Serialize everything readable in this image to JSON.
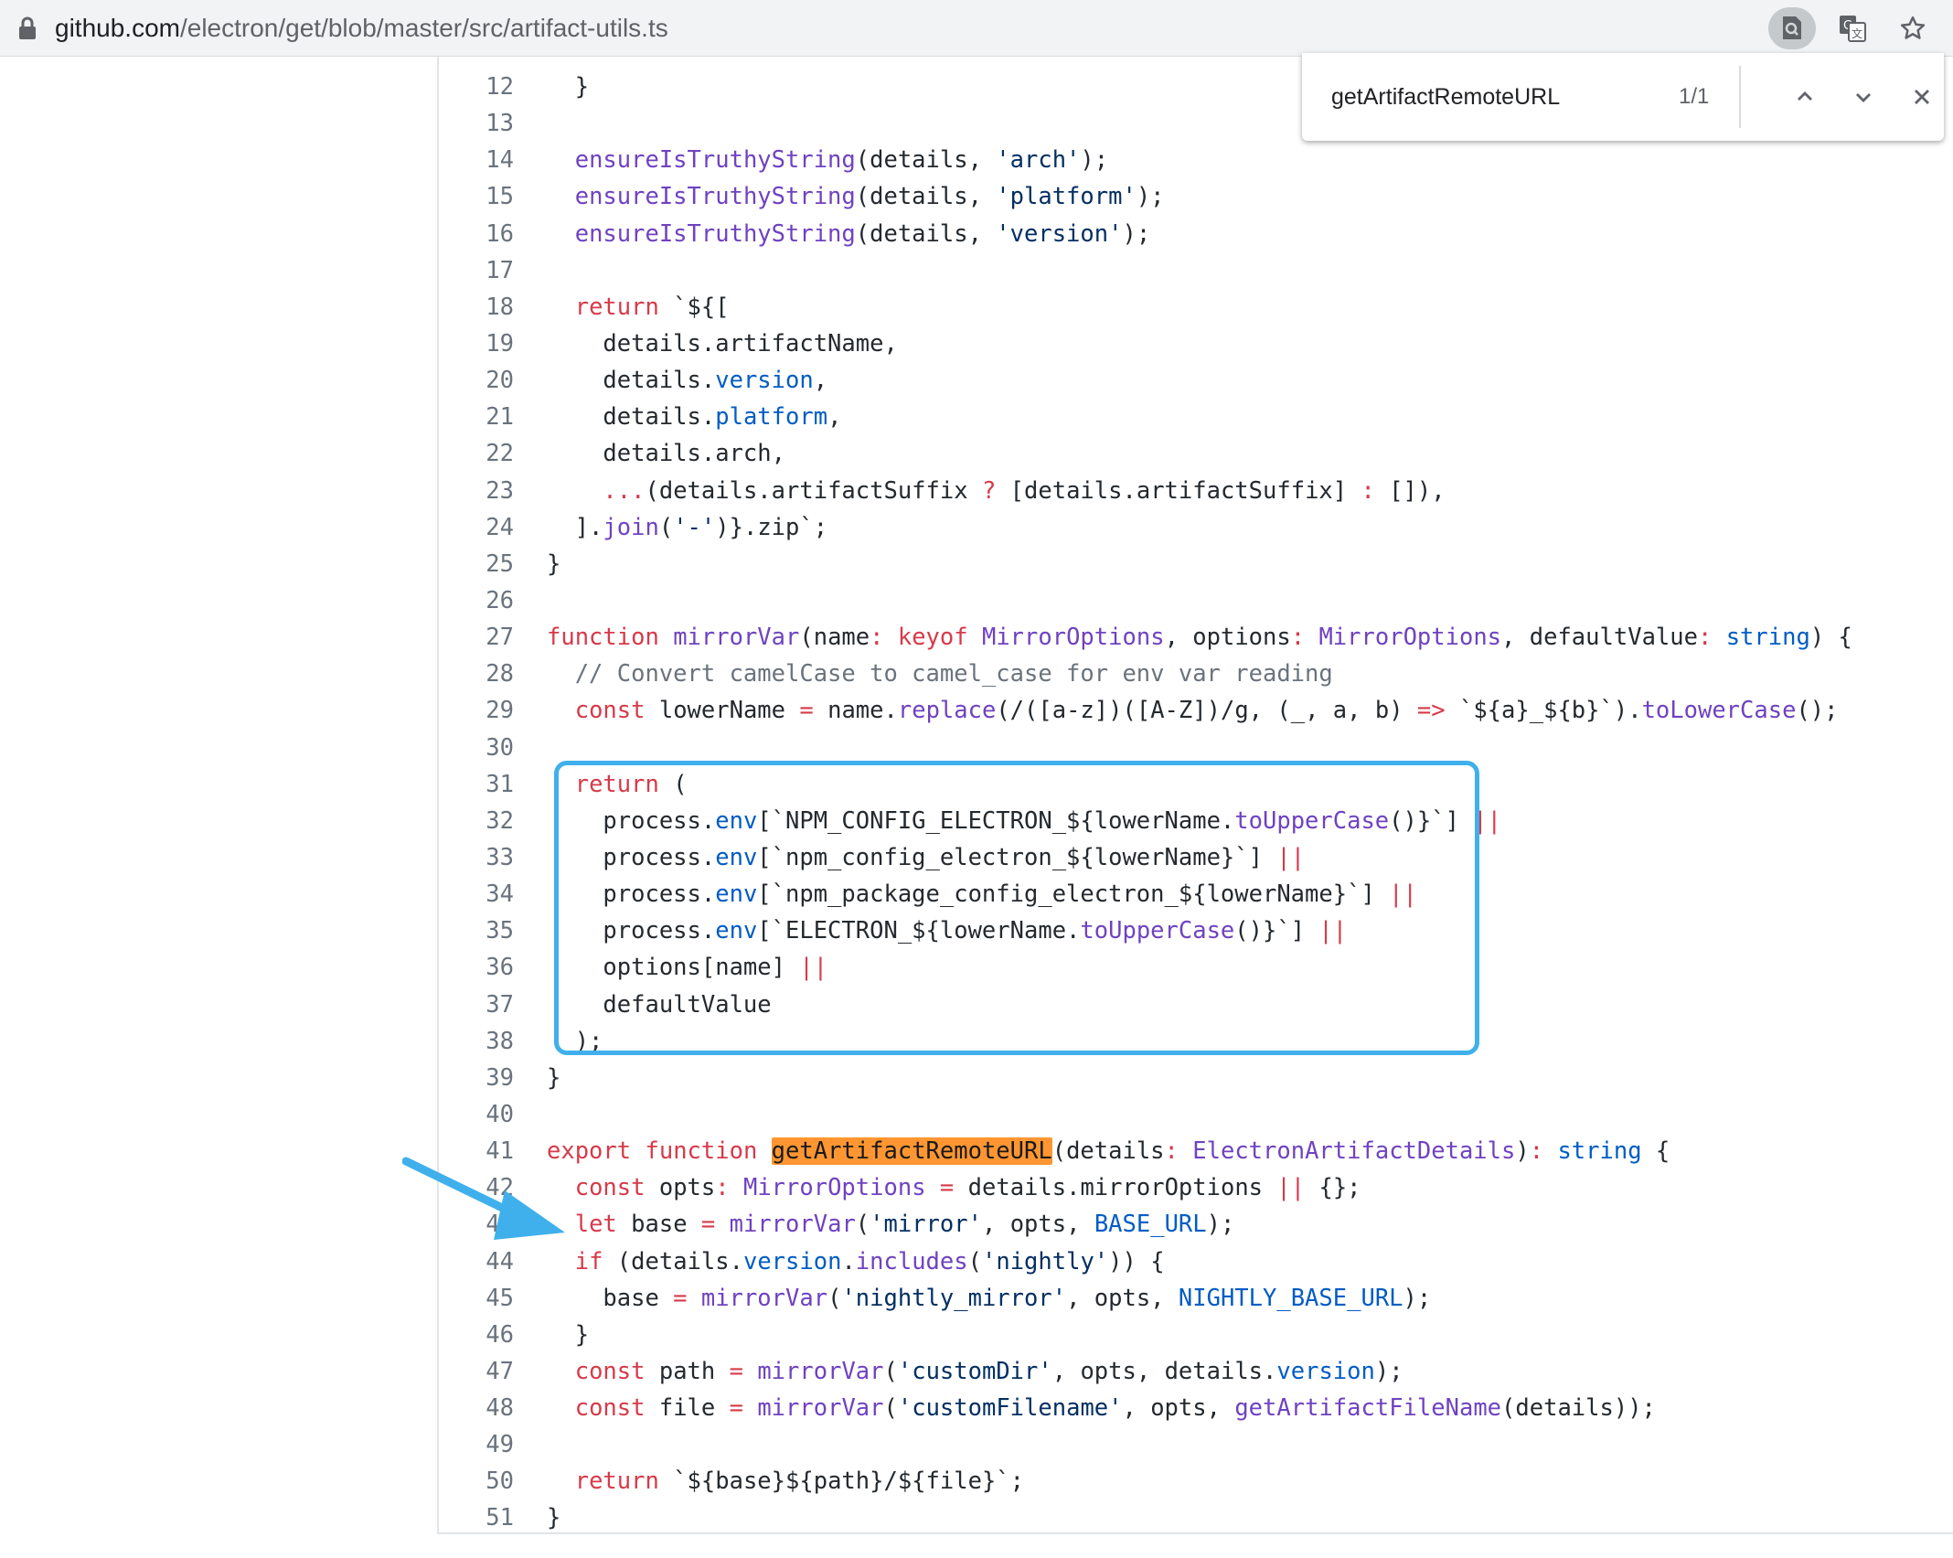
{
  "address_bar": {
    "url_domain": "github.com",
    "url_path": "/electron/get/blob/master/src/artifact-utils.ts"
  },
  "find_bar": {
    "query": "getArtifactRemoteURL",
    "count": "1/1"
  },
  "code": {
    "lines": [
      {
        "n": "12",
        "t": "  }"
      },
      {
        "n": "13",
        "t": ""
      },
      {
        "n": "14",
        "t": "  ensureIsTruthyString(details, 'arch');"
      },
      {
        "n": "15",
        "t": "  ensureIsTruthyString(details, 'platform');"
      },
      {
        "n": "16",
        "t": "  ensureIsTruthyString(details, 'version');"
      },
      {
        "n": "17",
        "t": ""
      },
      {
        "n": "18",
        "t": "  return `${["
      },
      {
        "n": "19",
        "t": "    details.artifactName,"
      },
      {
        "n": "20",
        "t": "    details.version,"
      },
      {
        "n": "21",
        "t": "    details.platform,"
      },
      {
        "n": "22",
        "t": "    details.arch,"
      },
      {
        "n": "23",
        "t": "    ...(details.artifactSuffix ? [details.artifactSuffix] : []),"
      },
      {
        "n": "24",
        "t": "  ].join('-')}.zip`;"
      },
      {
        "n": "25",
        "t": "}"
      },
      {
        "n": "26",
        "t": ""
      },
      {
        "n": "27",
        "t": "function mirrorVar(name: keyof MirrorOptions, options: MirrorOptions, defaultValue: string) {"
      },
      {
        "n": "28",
        "t": "  // Convert camelCase to camel_case for env var reading"
      },
      {
        "n": "29",
        "t": "  const lowerName = name.replace(/([a-z])([A-Z])/g, (_, a, b) => `${a}_${b}`).toLowerCase();"
      },
      {
        "n": "30",
        "t": ""
      },
      {
        "n": "31",
        "t": "  return ("
      },
      {
        "n": "32",
        "t": "    process.env[`NPM_CONFIG_ELECTRON_${lowerName.toUpperCase()}`] ||"
      },
      {
        "n": "33",
        "t": "    process.env[`npm_config_electron_${lowerName}`] ||"
      },
      {
        "n": "34",
        "t": "    process.env[`npm_package_config_electron_${lowerName}`] ||"
      },
      {
        "n": "35",
        "t": "    process.env[`ELECTRON_${lowerName.toUpperCase()}`] ||"
      },
      {
        "n": "36",
        "t": "    options[name] ||"
      },
      {
        "n": "37",
        "t": "    defaultValue"
      },
      {
        "n": "38",
        "t": "  );"
      },
      {
        "n": "39",
        "t": "}"
      },
      {
        "n": "40",
        "t": ""
      },
      {
        "n": "41",
        "t": "export function getArtifactRemoteURL(details: ElectronArtifactDetails): string {"
      },
      {
        "n": "42",
        "t": "  const opts: MirrorOptions = details.mirrorOptions || {};"
      },
      {
        "n": "43",
        "t": "  let base = mirrorVar('mirror', opts, BASE_URL);"
      },
      {
        "n": "44",
        "t": "  if (details.version.includes('nightly')) {"
      },
      {
        "n": "45",
        "t": "    base = mirrorVar('nightly_mirror', opts, NIGHTLY_BASE_URL);"
      },
      {
        "n": "46",
        "t": "  }"
      },
      {
        "n": "47",
        "t": "  const path = mirrorVar('customDir', opts, details.version);"
      },
      {
        "n": "48",
        "t": "  const file = mirrorVar('customFilename', opts, getArtifactFileName(details));"
      },
      {
        "n": "49",
        "t": ""
      },
      {
        "n": "50",
        "t": "  return `${base}${path}/${file}`;"
      },
      {
        "n": "51",
        "t": "}"
      }
    ]
  },
  "colors": {
    "keyword": "#d73a49",
    "function": "#6f42c1",
    "string": "#032f62",
    "comment": "#6a737d",
    "parameter": "#e36209",
    "constant": "#005cc5",
    "search_highlight": "#ff9632",
    "annotation": "#3fb0ec"
  },
  "icons": [
    "lock-icon",
    "search-page-icon",
    "translate-icon",
    "bookmark-star-icon",
    "chevron-up-icon",
    "chevron-down-icon",
    "close-icon",
    "arrow-annotation"
  ]
}
